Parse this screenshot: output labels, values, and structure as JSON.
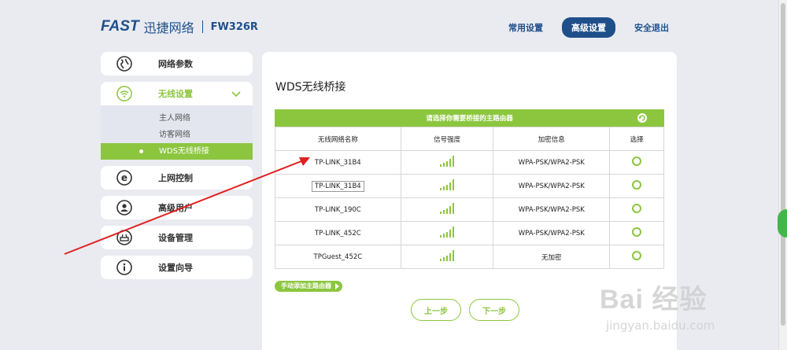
{
  "header": {
    "brand": "FAST",
    "brand_cn": "迅捷网络",
    "model": "FW326R",
    "nav": {
      "common": "常用设置",
      "advanced": "高级设置",
      "logout": "安全退出"
    }
  },
  "sidebar": {
    "items": [
      {
        "label": "网络参数",
        "icon": "globe-icon"
      },
      {
        "label": "无线设置",
        "icon": "wifi-icon"
      },
      {
        "label": "上网控制",
        "icon": "ie-icon"
      },
      {
        "label": "高级用户",
        "icon": "user-icon"
      },
      {
        "label": "设备管理",
        "icon": "router-icon"
      },
      {
        "label": "设置向导",
        "icon": "info-icon"
      }
    ],
    "wireless_sub": [
      "主人网络",
      "访客网络",
      "WDS无线桥接"
    ]
  },
  "main": {
    "title": "WDS无线桥接",
    "table_banner": "请选择你需要桥接的主路由器",
    "columns": [
      "无线网络名称",
      "信号强度",
      "加密信息",
      "选择"
    ],
    "rows": [
      {
        "ssid": "TP-LINK_31B4",
        "encryption": "WPA-PSK/WPA2-PSK"
      },
      {
        "ssid": "TP-LINK_31B4",
        "encryption": "WPA-PSK/WPA2-PSK"
      },
      {
        "ssid": "TP-LINK_190C",
        "encryption": "WPA-PSK/WPA2-PSK"
      },
      {
        "ssid": "TP-LINK_452C",
        "encryption": "WPA-PSK/WPA2-PSK"
      },
      {
        "ssid": "TPGuest_452C",
        "encryption": "无加密"
      }
    ],
    "manual_add": "手动添加主路由器",
    "prev": "上一步",
    "next": "下一步"
  },
  "watermark": {
    "brand": "Bai 经验",
    "url": "jingyan.baidu.com"
  },
  "colors": {
    "accent": "#8cc63f",
    "brand": "#1f4f8b",
    "annotation_arrow": "#e02020"
  }
}
